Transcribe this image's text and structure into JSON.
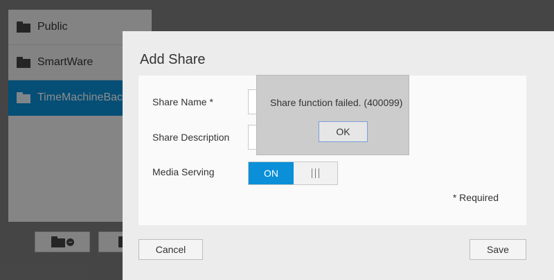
{
  "shares": [
    {
      "name": "Public",
      "selected": false
    },
    {
      "name": "SmartWare",
      "selected": false
    },
    {
      "name": "TimeMachineBac",
      "selected": true
    }
  ],
  "dialog": {
    "title": "Add Share",
    "fields": {
      "share_name_label": "Share Name *",
      "share_description_label": "Share Description",
      "media_serving_label": "Media Serving"
    },
    "media_serving": {
      "state": "ON"
    },
    "required_note": "* Required",
    "cancel_label": "Cancel",
    "save_label": "Save"
  },
  "error": {
    "message": "Share function failed. (400099)",
    "ok_label": "OK"
  },
  "colors": {
    "accent": "#0a8fd8",
    "overlay": "#7f7f7f",
    "dialog_bg": "#ececec"
  }
}
